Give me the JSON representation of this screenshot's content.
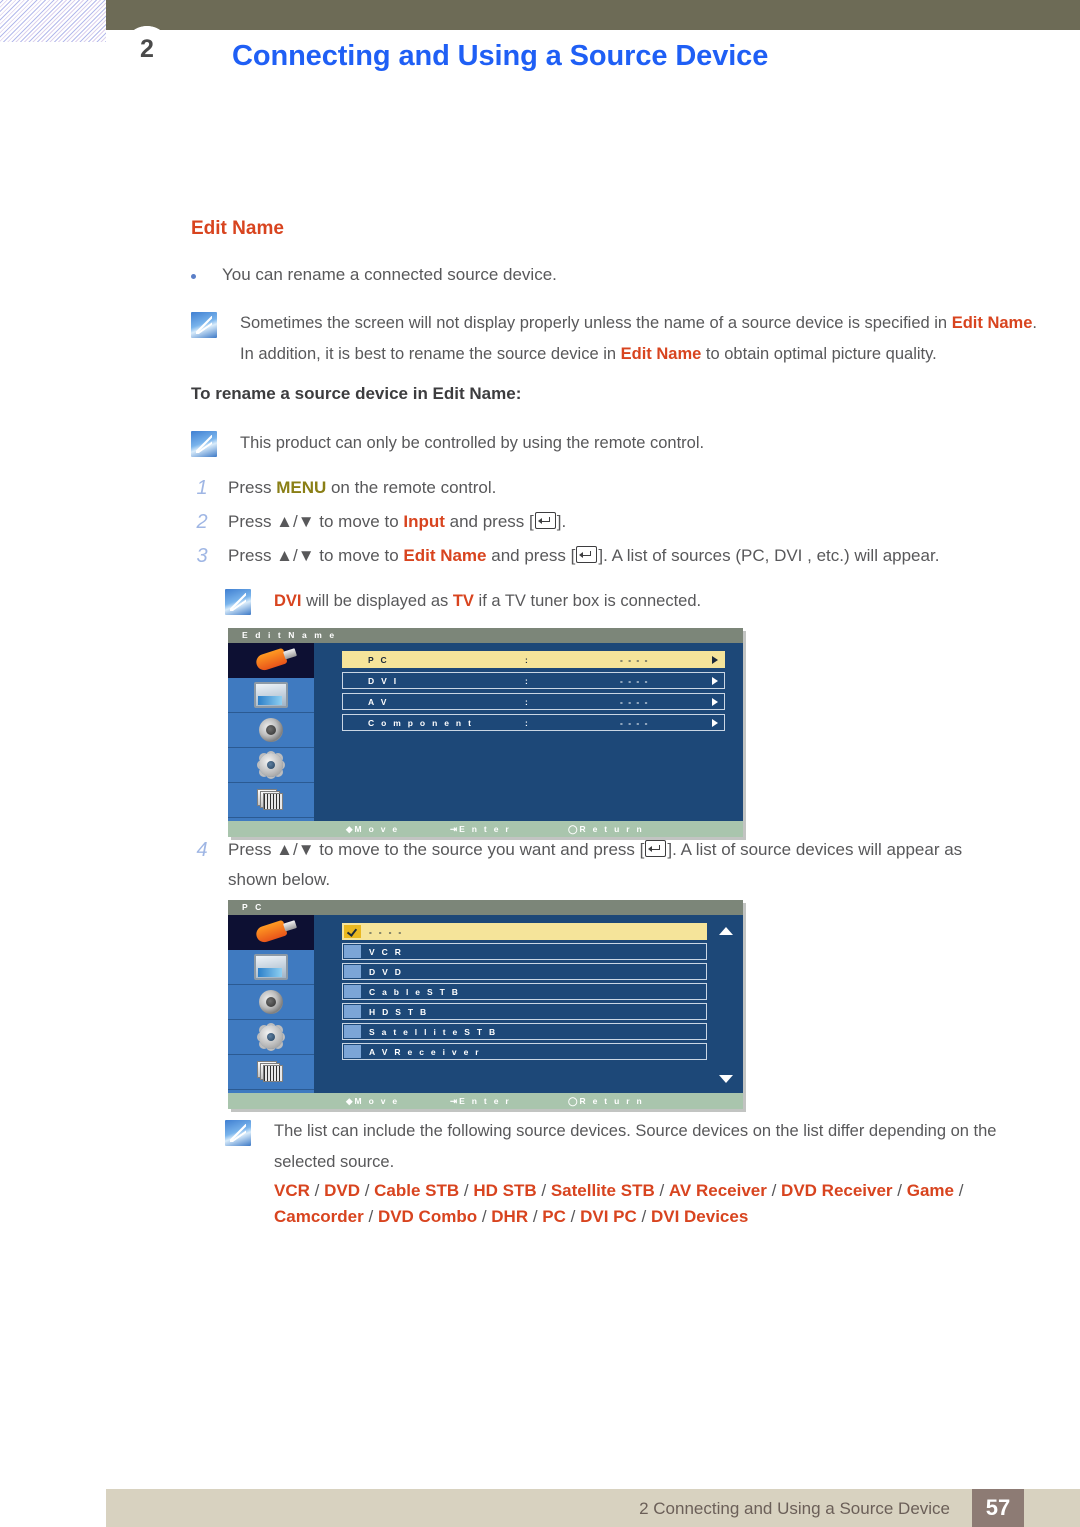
{
  "header": {
    "chapter_badge": "2",
    "title": "Connecting and Using a Source Device"
  },
  "section": {
    "title": "Edit Name",
    "bullet": "You can rename a connected source device."
  },
  "notes": {
    "note1_a": "Sometimes the screen will not display properly unless the name of a source device is specified in ",
    "note1_b": "Edit",
    "note1_c": "Name",
    "note1_d": ". In addition, it is best to rename the source device in ",
    "note1_e": "Edit Name",
    "note1_f": " to obtain optimal picture quality.",
    "note2": "This product can only be controlled by using the remote control.",
    "note3_a": "DVI",
    "note3_b": " will be displayed as ",
    "note3_c": "TV",
    "note3_d": " if a TV tuner box is connected.",
    "note4_line1": "The list can include the following source devices. Source devices on the list differ depending on the",
    "note4_line2": "selected source."
  },
  "subheading": "To rename a source device in Edit Name:",
  "steps": [
    {
      "num": "1",
      "pre": "Press ",
      "key": "MENU",
      "post": " on the remote control.",
      "post2": ""
    },
    {
      "num": "2",
      "pre": "Press ▲/▼ to move to ",
      "key": "Input",
      "post": " and press [",
      "post2": "]."
    },
    {
      "num": "3",
      "pre": "Press ▲/▼ to move to ",
      "key": "Edit Name",
      "post": " and press [",
      "post2": "]. A list of sources (PC, DVI , etc.) will appear."
    },
    {
      "num": "4",
      "pre": "Press ▲/▼ to move to the source you want and press [",
      "key": "",
      "post": "",
      "post2": "]. A list of source devices will appear as",
      "line2": "shown below."
    }
  ],
  "osd1": {
    "title": "E d i t   N a m e",
    "side_icons": [
      "input-plug-icon",
      "picture-monitor-icon",
      "sound-speaker-icon",
      "setup-gear-icon",
      "multi-control-stack-icon"
    ],
    "rows": [
      {
        "label": "P C",
        "colon": ":",
        "value": "- - - -",
        "selected": true
      },
      {
        "label": "D V I",
        "colon": ":",
        "value": "- - - -",
        "selected": false
      },
      {
        "label": "A V",
        "colon": ":",
        "value": "- - - -",
        "selected": false
      },
      {
        "label": "C o m p o n e n t",
        "colon": ":",
        "value": "- - - -",
        "selected": false
      }
    ],
    "footer": {
      "move": "M o v e",
      "enter": "E n t e r",
      "return": "R e t u r n"
    }
  },
  "osd2": {
    "title": "P C",
    "side_icons": [
      "input-plug-icon",
      "picture-monitor-icon",
      "sound-speaker-icon",
      "setup-gear-icon",
      "multi-control-stack-icon"
    ],
    "rows": [
      {
        "label": "- - - -",
        "selected": true
      },
      {
        "label": "V C R",
        "selected": false
      },
      {
        "label": "D V D",
        "selected": false
      },
      {
        "label": "C a b l e   S T B",
        "selected": false
      },
      {
        "label": "H D   S T B",
        "selected": false
      },
      {
        "label": "S a t e l l i t e   S T B",
        "selected": false
      },
      {
        "label": "A V   R e c e i v e r",
        "selected": false
      }
    ],
    "footer": {
      "move": "M o v e",
      "enter": "E n t e r",
      "return": "R e t u r n"
    }
  },
  "source_devices": {
    "line1": [
      "VCR",
      "DVD",
      "Cable STB",
      "HD STB",
      "Satellite STB",
      "AV Receiver",
      "DVD Receiver",
      "Game"
    ],
    "line2": [
      "Camcorder",
      "DVD Combo",
      "DHR",
      "PC",
      "DVI PC",
      "DVI Devices"
    ]
  },
  "footer": {
    "text": "2 Connecting and Using a Source Device",
    "page": "57"
  },
  "colors": {
    "accent_red": "#d8441f",
    "header_blue": "#1f5ff5",
    "header_bar": "#6d6b56",
    "footer_bar": "#d8d2c0",
    "page_badge": "#8d7b74",
    "osd_blue": "#1d4878",
    "osd_highlight": "#f5e49a",
    "osd_footer_green": "#a9c5ad"
  }
}
